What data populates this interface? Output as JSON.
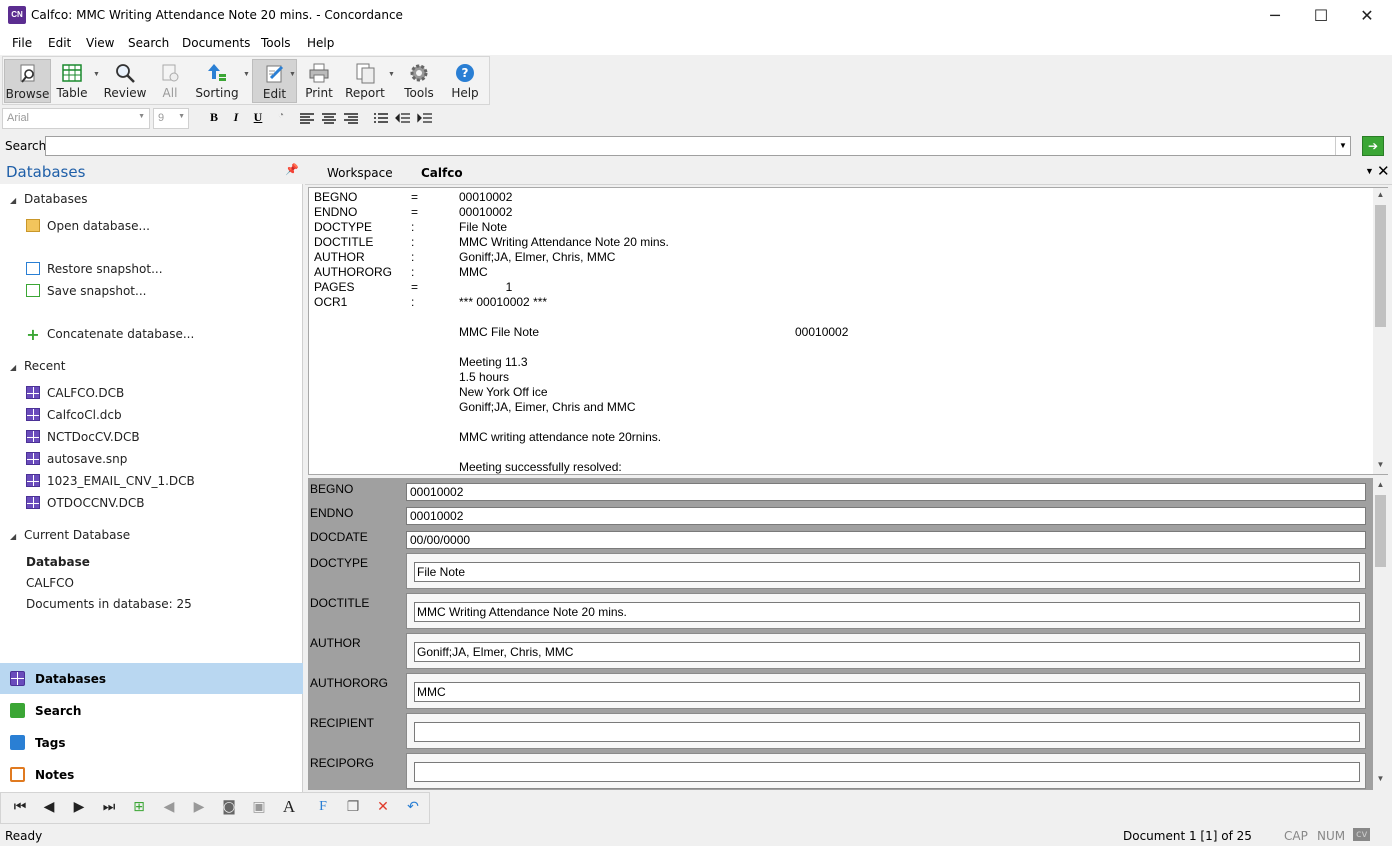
{
  "window": {
    "app_icon_text": "CN",
    "title": "Calfco: MMC Writing Attendance Note 20 mins. - Concordance",
    "minimize": "─",
    "maximize": "☐",
    "close": "✕"
  },
  "menu": [
    "File",
    "Edit",
    "View",
    "Search",
    "Documents",
    "Tools",
    "Help"
  ],
  "ribbon": [
    {
      "label": "Browse",
      "icon": "browse-icon",
      "active": true
    },
    {
      "label": "Table",
      "icon": "table-icon"
    },
    {
      "label": "Review",
      "icon": "review-icon"
    },
    {
      "label": "All",
      "icon": "all-icon",
      "disabled": true
    },
    {
      "label": "Sorting",
      "icon": "sorting-icon"
    },
    {
      "label": "Edit",
      "icon": "edit-icon",
      "active": true
    },
    {
      "label": "Print",
      "icon": "print-icon"
    },
    {
      "label": "Report",
      "icon": "report-icon"
    },
    {
      "label": "Tools",
      "icon": "tools-icon"
    },
    {
      "label": "Help",
      "icon": "help-icon"
    }
  ],
  "format": {
    "font": "Arial",
    "size": "9",
    "bold": "B",
    "italic": "I",
    "underline": "U"
  },
  "search": {
    "label": "Search",
    "value": "",
    "go_icon": "➔"
  },
  "left_panel": {
    "title": "Databases",
    "pin_icon": "pin-icon",
    "sections": {
      "databases": "Databases",
      "open_database": "Open database...",
      "restore_snapshot": "Restore snapshot...",
      "save_snapshot": "Save snapshot...",
      "concatenate": "Concatenate database...",
      "recent": "Recent",
      "current_database": "Current Database"
    },
    "recent": [
      "CALFCO.DCB",
      "CalfcoCl.dcb",
      "NCTDocCV.DCB",
      "autosave.snp",
      "1023_EMAIL_CNV_1.DCB",
      "OTDOCCNV.DCB"
    ],
    "current": {
      "heading": "Database",
      "name": "CALFCO",
      "count": "Documents in database: 25"
    }
  },
  "nav": [
    {
      "label": "Databases",
      "color": "#6a4cbc",
      "selected": true
    },
    {
      "label": "Search",
      "color": "#3ba635"
    },
    {
      "label": "Tags",
      "color": "#2a7fd4"
    },
    {
      "label": "Notes",
      "color": "#e07a20"
    }
  ],
  "tabs": {
    "workspace": "Workspace",
    "database": "Calfco"
  },
  "document": {
    "fields": [
      {
        "name": "BEGNO",
        "sep": "=",
        "value": "00010002"
      },
      {
        "name": "ENDNO",
        "sep": "=",
        "value": "00010002"
      },
      {
        "name": "DOCTYPE",
        "sep": ":",
        "value": "File Note"
      },
      {
        "name": "DOCTITLE",
        "sep": ":",
        "value": "MMC Writing Attendance Note 20 mins."
      },
      {
        "name": "AUTHOR",
        "sep": ":",
        "value": "Goniff;JA, Elmer, Chris, MMC"
      },
      {
        "name": "AUTHORORG",
        "sep": ":",
        "value": "MMC"
      },
      {
        "name": "PAGES",
        "sep": "=",
        "value": "              1"
      },
      {
        "name": "OCR1",
        "sep": ":",
        "value": "*** 00010002 ***"
      }
    ],
    "ocr_lines": [
      {
        "text": "MMC File Note",
        "right": "00010002"
      },
      {
        "text": "Meeting 11.3"
      },
      {
        "text": "1.5 hours"
      },
      {
        "text": "New York Off ice"
      },
      {
        "text": "Goniff;JA, Eimer, Chris and MMC"
      },
      {
        "text": "MMC writing attendance note 20rnins."
      },
      {
        "text": "Meeting successfully resolved:"
      }
    ]
  },
  "edit_fields": [
    {
      "label": "BEGNO",
      "value": "00010002"
    },
    {
      "label": "ENDNO",
      "value": "00010002"
    },
    {
      "label": "DOCDATE",
      "value": "00/00/0000"
    },
    {
      "label": "DOCTYPE",
      "value": "File Note"
    },
    {
      "label": "DOCTITLE",
      "value": "MMC Writing Attendance Note 20 mins."
    },
    {
      "label": "AUTHOR",
      "value": "Goniff;JA, Elmer, Chris, MMC"
    },
    {
      "label": "AUTHORORG",
      "value": "MMC"
    },
    {
      "label": "RECIPIENT",
      "value": ""
    },
    {
      "label": "RECIPORG",
      "value": ""
    }
  ],
  "status": {
    "ready": "Ready",
    "document": "Document 1 [1] of 25",
    "cap": "CAP",
    "num": "NUM",
    "cv": "cv"
  }
}
